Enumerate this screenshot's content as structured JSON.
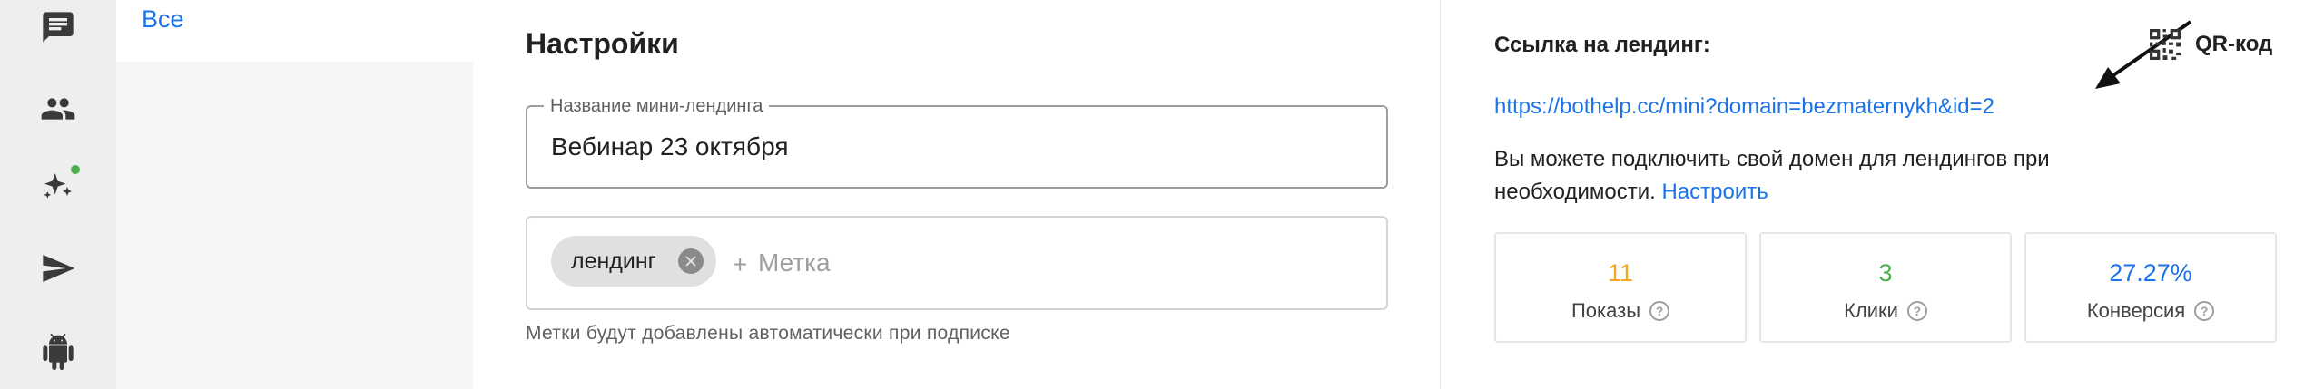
{
  "rail": {
    "icons": [
      {
        "name": "chat-icon"
      },
      {
        "name": "users-icon"
      },
      {
        "name": "sparkles-icon",
        "status_color": "#4caf50"
      },
      {
        "name": "send-icon"
      },
      {
        "name": "android-icon"
      }
    ]
  },
  "subnav": {
    "all_label": "Все"
  },
  "settings": {
    "title": "Настройки",
    "name_field": {
      "label": "Название мини-лендинга",
      "value": "Вебинар 23 октября"
    },
    "tags": {
      "chips": [
        "лендинг"
      ],
      "plus": "+",
      "placeholder": "Метка",
      "hint": "Метки будут добавлены автоматически при подписке"
    }
  },
  "panel": {
    "link_label": "Ссылка на лендинг:",
    "qr_label": "QR-код",
    "link_url": "https://bothelp.cc/mini?domain=bezmaternykh&id=2",
    "note_text": "Вы можете подключить свой домен для лендингов при необходимости. ",
    "note_link": "Настроить",
    "stats": [
      {
        "value": "11",
        "label": "Показы",
        "color": "#f5a623"
      },
      {
        "value": "3",
        "label": "Клики",
        "color": "#4caf50"
      },
      {
        "value": "27.27%",
        "label": "Конверсия",
        "color": "#1a73e8"
      }
    ],
    "help_glyph": "?"
  },
  "colors": {
    "accent": "#1a73e8",
    "rail_bg": "#eeeeee",
    "subnav_bg": "#f5f5f5"
  }
}
